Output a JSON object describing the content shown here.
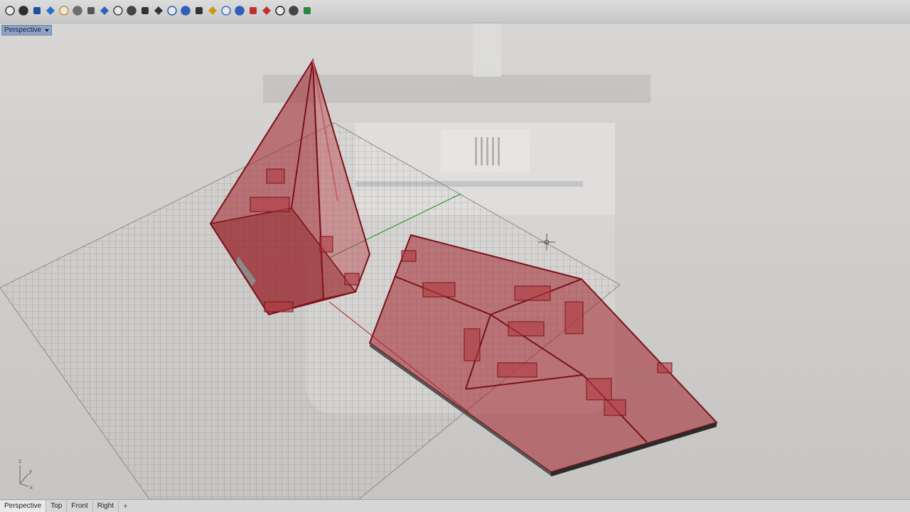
{
  "toolbar": {
    "icons": [
      "wireframe-viewport-icon",
      "shaded-viewport-icon",
      "rendered-viewport-icon",
      "ghosted-viewport-icon",
      "material-sphere-icon",
      "xray-viewport-icon",
      "technical-viewport-icon",
      "lasso-select-icon",
      "lock-icon",
      "unlock-icon",
      "show-icon",
      "hide-icon",
      "layers-icon",
      "object-properties-icon",
      "gumball-icon",
      "light-icon",
      "osnap-icon",
      "material-icon",
      "move-icon",
      "delete-icon",
      "display-icon",
      "cube-options-icon",
      "pan-icon"
    ]
  },
  "viewport": {
    "label": "Perspective",
    "axes": {
      "z": "z",
      "y": "y",
      "x": "x"
    }
  },
  "tabs": [
    {
      "label": "Perspective",
      "active": true
    },
    {
      "label": "Top",
      "active": false
    },
    {
      "label": "Front",
      "active": false
    },
    {
      "label": "Right",
      "active": false
    }
  ],
  "tab_add": "+",
  "colors": {
    "model": "#a3242c",
    "grid": "#6e6e6e",
    "label_bg": "#8fa3c4",
    "axis_x": "#b02020",
    "axis_y": "#1f8a1f"
  }
}
